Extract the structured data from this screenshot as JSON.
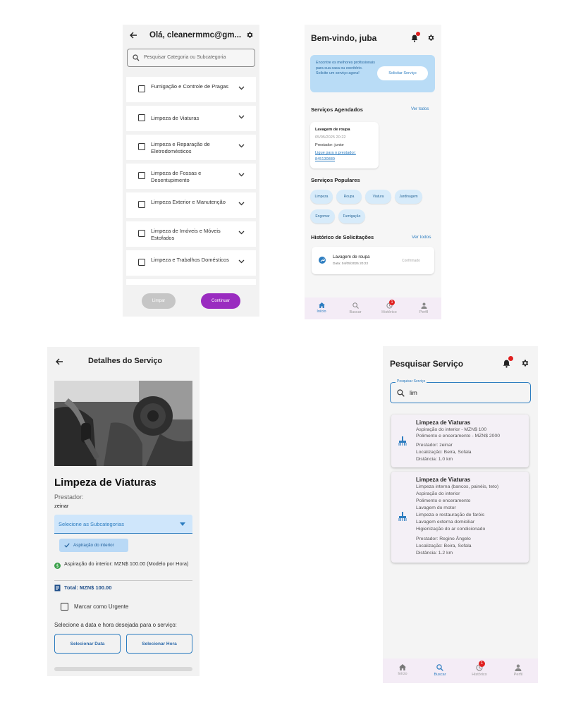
{
  "colors": {
    "accent": "#2d7dc0",
    "purple": "#9a2cc0",
    "badge": "#e02020"
  },
  "screen1": {
    "title": "Olá, cleanermmc@gm...",
    "search_placeholder": "Pesquisar Categoria ou Subcategoria",
    "categories": [
      {
        "label": "Fumigação e Controle de Pragas"
      },
      {
        "label": "Limpeza de Viaturas"
      },
      {
        "label": "Limpeza e Reparação de Eletrodomésticos"
      },
      {
        "label": "Limpeza de Fossas e Desentupimento"
      },
      {
        "label": "Limpeza Exterior e Manutenção"
      },
      {
        "label": "Limpeza de Imóveis e Móveis Estofados"
      },
      {
        "label": "Limpeza e Trabalhos Domésticos"
      }
    ],
    "clear_label": "Limpar",
    "continue_label": "Continuar"
  },
  "screen2": {
    "greeting": "Bem-vindo, juba",
    "banner_text": "Encontre os melhores profissionais para sua casa ou escritório. Solicite um serviço agora!",
    "banner_button": "Solicitar Serviço",
    "scheduled_title": "Serviços Agendados",
    "scheduled_see_all": "Ver todos",
    "appointment": {
      "service": "Lavagem de roupa",
      "date": "05/05/2025 20:22",
      "provider": "Prestador: junior",
      "call_label": "Ligue para o prestador:",
      "phone": "845130889"
    },
    "popular_title": "Serviços Populares",
    "popular": [
      "Limpeza",
      "Roupa",
      "Viatura",
      "Jardinagem",
      "Engomar",
      "Fumigação"
    ],
    "history_title": "Histórico de Solicitações",
    "history_see_all": "Ver todos",
    "history_item": {
      "service": "Lavagem de roupa",
      "date": "Data: 04/05/2025 20:22",
      "status": "Confirmado"
    },
    "nav": [
      "Início",
      "Buscar",
      "Histórico",
      "Perfil"
    ],
    "history_badge": "1"
  },
  "screen3": {
    "title": "Detalhes do Serviço",
    "service_name": "Limpeza de Viaturas",
    "provider_label": "Prestador:",
    "provider_name": "zeinar",
    "select_placeholder": "Selecione as Subcategorias",
    "selected_chip": "Aspiração do interior",
    "price_line": "Aspiração do interior: MZN$ 100.00 (Modelo por Hora)",
    "total": "Total: MZN$ 100.00",
    "urgent_label": "Marcar como Urgente",
    "datetime_prompt": "Selecione a data e hora desejada para o serviço:",
    "date_button": "Selecionar Data",
    "time_button": "Selecionar Hora"
  },
  "screen4": {
    "title": "Pesquisar Serviço",
    "search_label": "Pesquisar Serviço",
    "search_value": "lim",
    "results": [
      {
        "title": "Limpeza de Viaturas",
        "lines": [
          "Aspiração do interior - MZN$ 100",
          "Polimento e enceramento - MZN$ 2000"
        ],
        "provider": "Prestador: zeinar",
        "location": "Localização: Beira, Sofala",
        "distance": "Distância: 1.0 km"
      },
      {
        "title": "Limpeza de Viaturas",
        "lines": [
          "Limpeza interna (bancos, painéis, teto)",
          "Aspiração do interior",
          "Polimento e enceramento",
          "Lavagem do motor",
          "Limpeza e restauração de faróis",
          "Lavagem externa domiciliar",
          "Higienização do ar condicionado"
        ],
        "provider": "Prestador: Regino Ângelo",
        "location": "Localização: Beira, Sofala",
        "distance": "Distância: 1.2 km"
      }
    ],
    "nav": [
      "Início",
      "Buscar",
      "Histórico",
      "Perfil"
    ],
    "history_badge": "1"
  }
}
